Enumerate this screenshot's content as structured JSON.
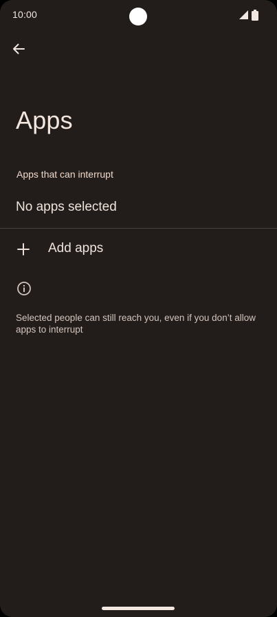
{
  "status_bar": {
    "time": "10:00",
    "icons": [
      "camera-cutout",
      "signal-icon",
      "battery-icon"
    ]
  },
  "header": {
    "back_icon": "arrow-back-icon",
    "title": "Apps"
  },
  "section": {
    "label": "Apps that can interrupt",
    "empty_text": "No apps selected"
  },
  "add_apps": {
    "icon": "plus-icon",
    "label": "Add apps"
  },
  "info": {
    "icon": "info-icon",
    "text": "Selected people can still reach you, even if you don’t allow apps to interrupt"
  },
  "colors": {
    "background": "#221d1a",
    "primary_text": "#ede0d9",
    "section_label": "#f0d9cc",
    "secondary_text": "#d3c4bc",
    "divider": "#4a403b"
  }
}
